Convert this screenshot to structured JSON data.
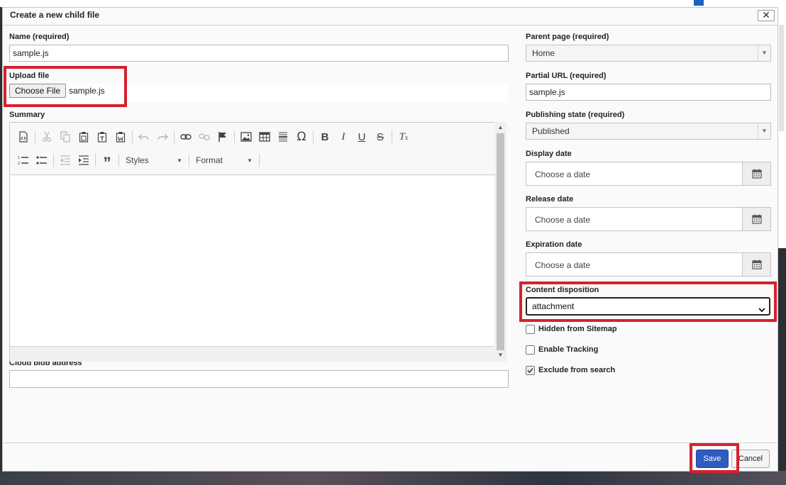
{
  "dialog": {
    "title": "Create a new child file",
    "close_glyph": "✕"
  },
  "form_left": {
    "name": {
      "label": "Name (required)",
      "value": "sample.js"
    },
    "upload": {
      "label": "Upload file",
      "button_label": "Choose File",
      "file_name": "sample.js"
    },
    "summary": {
      "label": "Summary",
      "toolbar": {
        "row1_icons": [
          "source-icon",
          "cut-icon",
          "copy-icon",
          "paste-icon",
          "paste-text-icon",
          "paste-word-icon",
          "undo-icon",
          "redo-icon",
          "link-icon",
          "unlink-icon",
          "anchor-flag-icon",
          "image-icon",
          "table-icon",
          "horizontal-line-icon",
          "special-char-icon",
          "bold-icon",
          "italic-icon",
          "underline-icon",
          "strikethrough-icon",
          "remove-format-icon"
        ],
        "row2_icons": [
          "numbered-list-icon",
          "bulleted-list-icon",
          "decrease-indent-icon",
          "increase-indent-icon",
          "blockquote-icon"
        ],
        "styles_label": "Styles",
        "format_label": "Format"
      }
    },
    "blob": {
      "label": "Cloud blob address",
      "value": ""
    }
  },
  "form_right": {
    "parent_page": {
      "label": "Parent page (required)",
      "value": "Home"
    },
    "partial_url": {
      "label": "Partial URL (required)",
      "value": "sample.js"
    },
    "publishing_state": {
      "label": "Publishing state (required)",
      "value": "Published"
    },
    "display_date": {
      "label": "Display date",
      "placeholder": "Choose a date"
    },
    "release_date": {
      "label": "Release date",
      "placeholder": "Choose a date"
    },
    "expiration_date": {
      "label": "Expiration date",
      "placeholder": "Choose a date"
    },
    "content_disposition": {
      "label": "Content disposition",
      "value": "attachment"
    },
    "checkboxes": [
      {
        "label": "Hidden from Sitemap",
        "checked": false
      },
      {
        "label": "Enable Tracking",
        "checked": false
      },
      {
        "label": "Exclude from search",
        "checked": true
      }
    ]
  },
  "footer": {
    "save_label": "Save",
    "cancel_label": "Cancel"
  },
  "colors": {
    "highlight": "#d6202f",
    "save_button": "#2f5cc0",
    "text": "#222222"
  }
}
